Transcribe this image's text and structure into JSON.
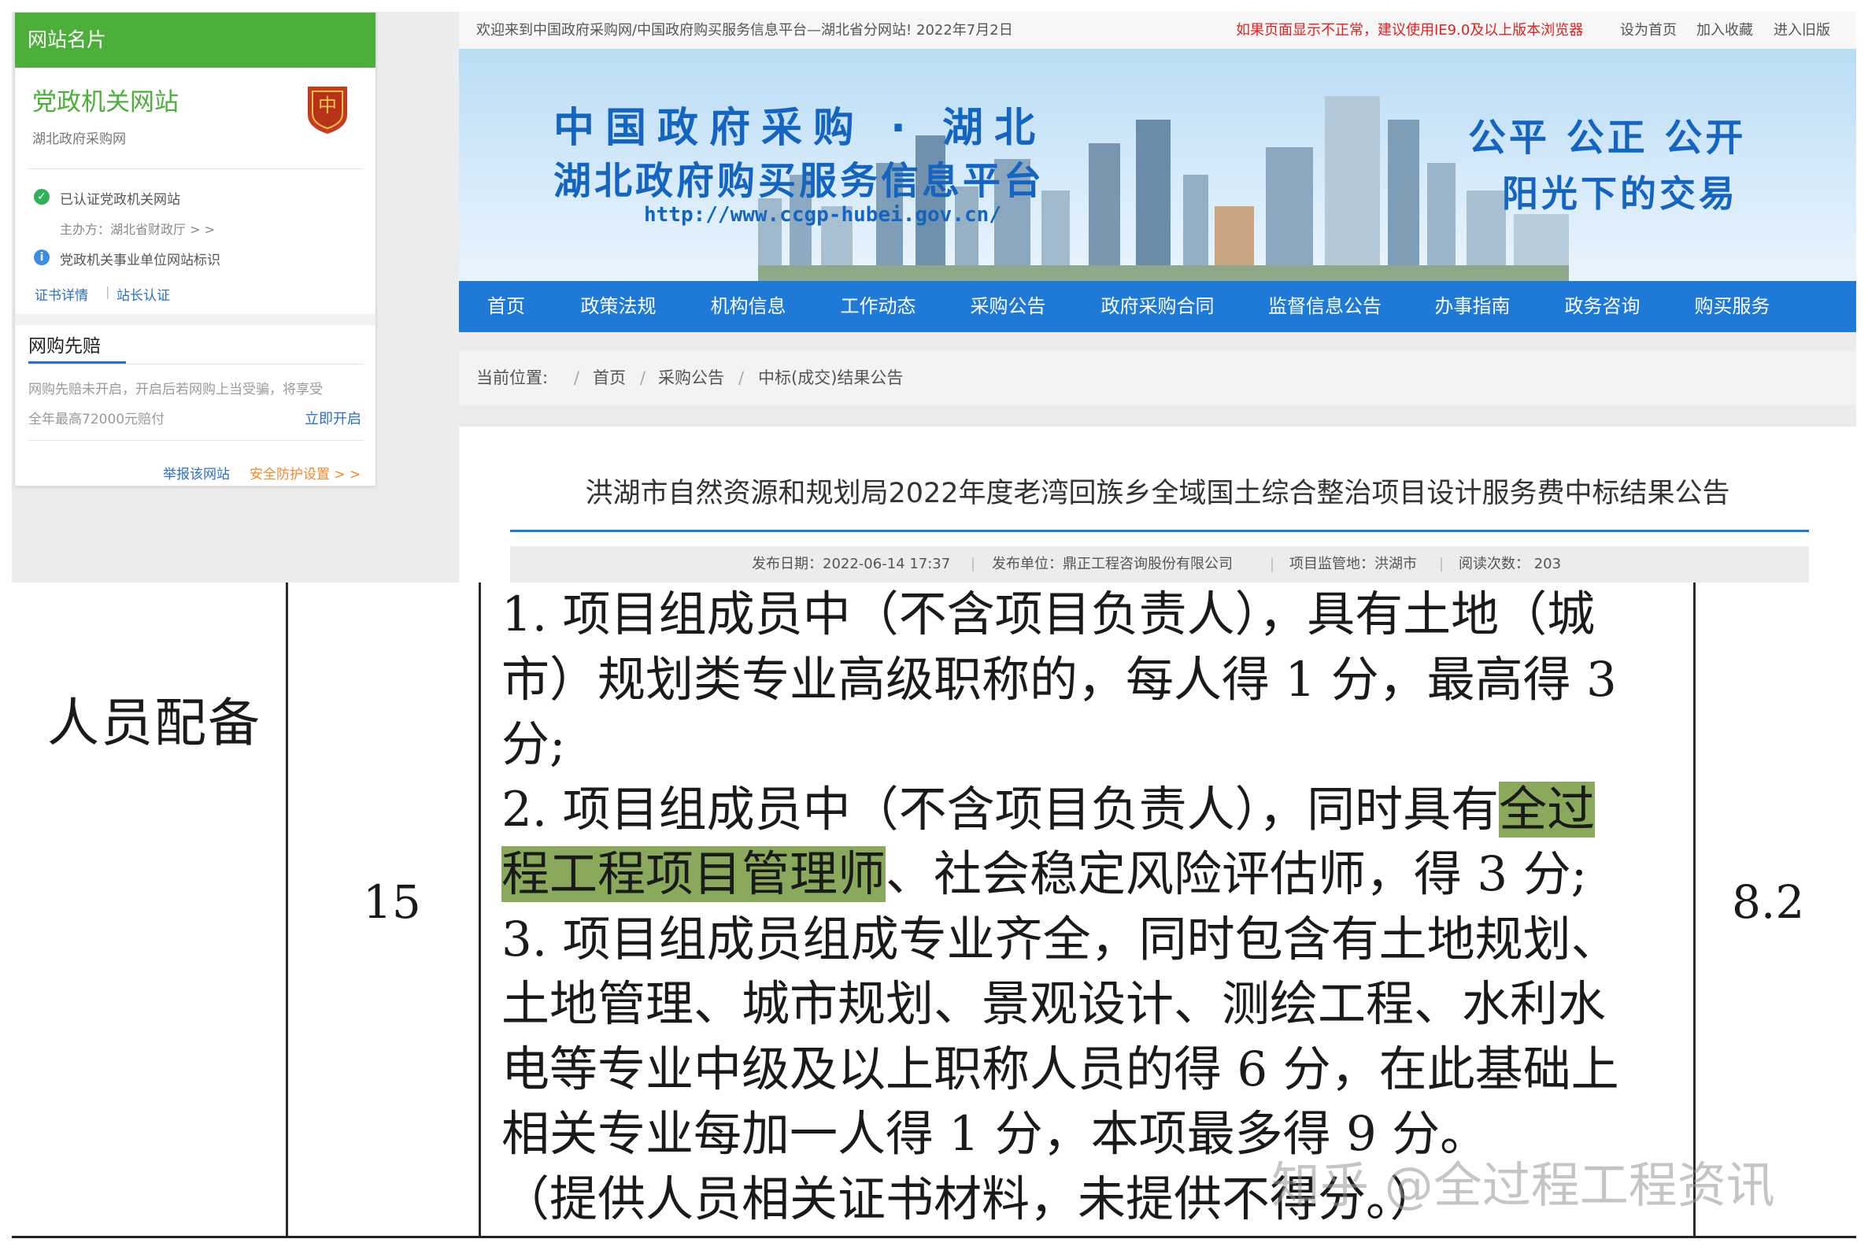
{
  "site_card": {
    "header": "网站名片",
    "site_name": "党政机关网站",
    "site_sub": "湖北政府采购网",
    "verified_label": "已认证党政机关网站",
    "sponsor": "主办方：湖北省财政厅 > >",
    "info_label": "党政机关事业单位网站标识",
    "cert_link": "证书详情",
    "link_sep": "|",
    "owner_link": "站长认证",
    "emblem_text": "党政机关"
  },
  "online_pay": {
    "title": "网购先赔",
    "desc_line1": "网购先赔未开启，开启后若网购上当受骗，将享受",
    "desc_line2": "全年最高72000元赔付",
    "open_link": "立即开启",
    "report_link": "举报该网站",
    "security_link": "安全防护设置 > >"
  },
  "topbar": {
    "welcome": "欢迎来到中国政府采购网/中国政府购买服务信息平台—湖北省分网站!  2022年7月2日",
    "ie_notice": "如果页面显示不正常，建议使用IE9.0及以上版本浏览器",
    "set_home": "设为首页",
    "add_favorite": "加入收藏",
    "old_version": "进入旧版"
  },
  "banner": {
    "title_line1": "中国政府采购 · 湖北",
    "title_line2": "湖北政府购买服务信息平台",
    "url": "http://www.ccgp-hubei.gov.cn/",
    "slogan_line1": "公平  公正  公开",
    "slogan_line2": "阳光下的交易"
  },
  "nav": {
    "items": [
      "首页",
      "政策法规",
      "机构信息",
      "工作动态",
      "采购公告",
      "政府采购合同",
      "监督信息公告",
      "办事指南",
      "政务咨询",
      "购买服务"
    ]
  },
  "breadcrumb": {
    "label": "当前位置:",
    "items": [
      "首页",
      "采购公告",
      "中标(成交)结果公告"
    ],
    "sep": "/"
  },
  "article": {
    "title": "洪湖市自然资源和规划局2022年度老湾回族乡全域国土综合整治项目设计服务费中标结果公告",
    "publish_date": "发布日期：2022-06-14 17:37",
    "publisher": "发布单位：鼎正工程咨询股份有限公司",
    "supervision": "项目监管地：洪湖市",
    "views": "阅读次数：  203"
  },
  "scoring_row": {
    "label": "人员配备",
    "points": "15",
    "score": "8.2",
    "criteria_lines": [
      "1. 项目组成员中（不含项目负责人），具有土地（城",
      "市）规划类专业高级职称的，每人得 1 分，最高得 3",
      "分;",
      "2. 项目组成员中（不含项目负责人），同时具有",
      "全过",
      "程工程项目管理师",
      "、社会稳定风险评估师，得 3 分;",
      "3. 项目组成员组成专业齐全，同时包含有土地规划、",
      "土地管理、城市规划、景观设计、测绘工程、水利水",
      "电等专业中级及以上职称人员的得 6 分，在此基础上",
      "相关专业每加一人得 1 分，本项最多得 9 分。",
      "（提供人员相关证书材料，未提供不得分。）"
    ]
  },
  "watermark": "知乎 @全过程工程资讯",
  "colors": {
    "green": "#4caf39",
    "nav_blue": "#1e7ad6",
    "banner_blue": "#1565c0",
    "highlight": "#8ba95c",
    "notice_red": "#e02020"
  }
}
